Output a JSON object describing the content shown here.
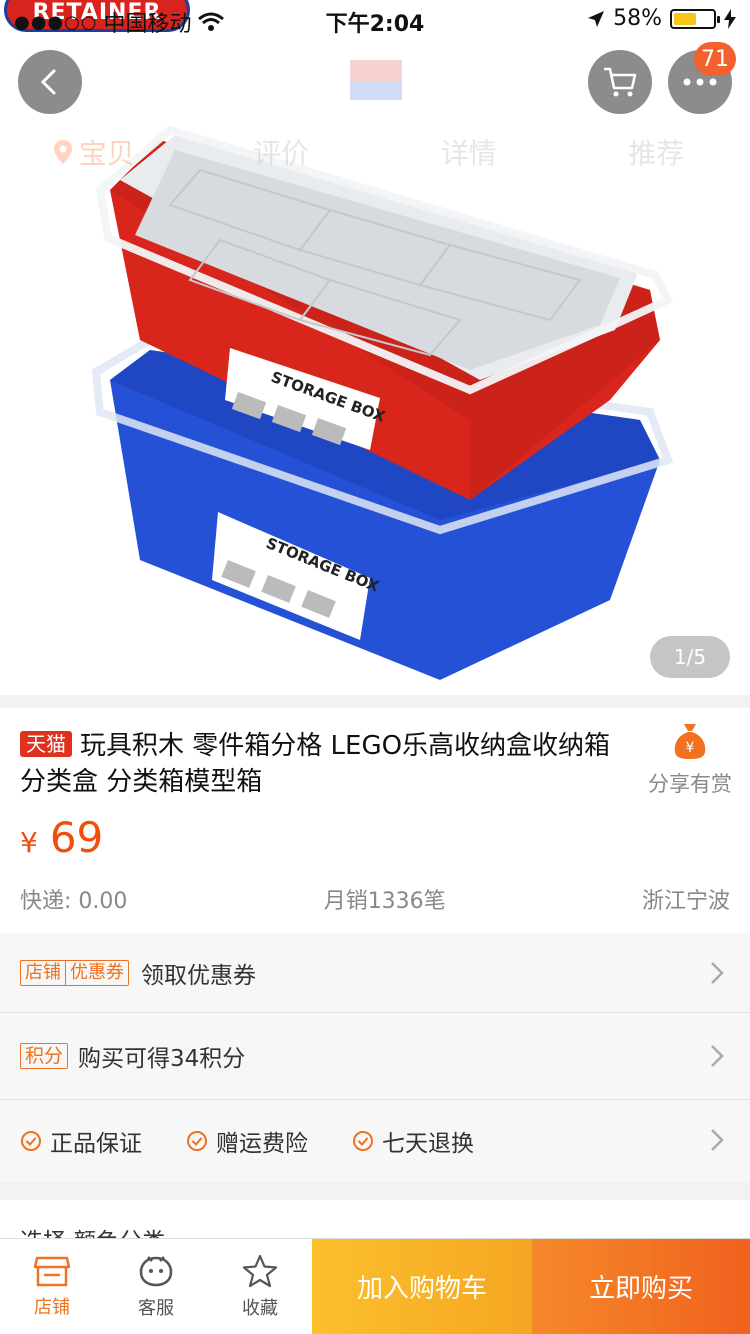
{
  "status_bar": {
    "signal_dots": "●●●○○",
    "carrier": "中国移动",
    "time": "下午2:04",
    "battery_percent_label": "58%",
    "battery_level": 0.58
  },
  "brand_badge": "RETAINER",
  "nav": {
    "notification_count": "71",
    "tabs": [
      {
        "label": "宝贝"
      },
      {
        "label": "评价"
      },
      {
        "label": "详情"
      },
      {
        "label": "推荐"
      }
    ]
  },
  "gallery": {
    "counter": "1/5",
    "box_label": "STORAGE BOX"
  },
  "product": {
    "store_tag": "天猫",
    "title": "玩具积木 零件箱分格 LEGO乐高收纳盒收纳箱 分类盒 分类箱模型箱",
    "currency": "¥",
    "price": "69",
    "shipping": "快递: 0.00",
    "monthly_sales": "月销1336笔",
    "location": "浙江宁波",
    "share_label": "分享有赏"
  },
  "rows": {
    "coupon_tag_1": "店铺",
    "coupon_tag_2": "优惠券",
    "coupon_text": "领取优惠券",
    "points_tag": "积分",
    "points_text": "购买可得34积分",
    "guarantees": [
      "正品保证",
      "赠运费险",
      "七天退换"
    ],
    "select_text": "选择 颜色分类"
  },
  "bottom_bar": {
    "store": "店铺",
    "service": "客服",
    "favorite": "收藏",
    "add_to_cart": "加入购物车",
    "buy_now": "立即购买"
  },
  "colors": {
    "accent": "#f0500a",
    "tmall_red": "#e0301e",
    "cart_yellow": "#fbc02d",
    "buy_orange": "#f0611e",
    "box_red": "#d8261c",
    "box_blue": "#2451d6"
  },
  "icons": [
    "back-arrow-icon",
    "cart-icon",
    "more-icon",
    "location-pin-icon",
    "money-bag-icon",
    "chevron-right-icon",
    "check-circle-icon",
    "store-icon",
    "service-face-icon",
    "star-icon"
  ]
}
